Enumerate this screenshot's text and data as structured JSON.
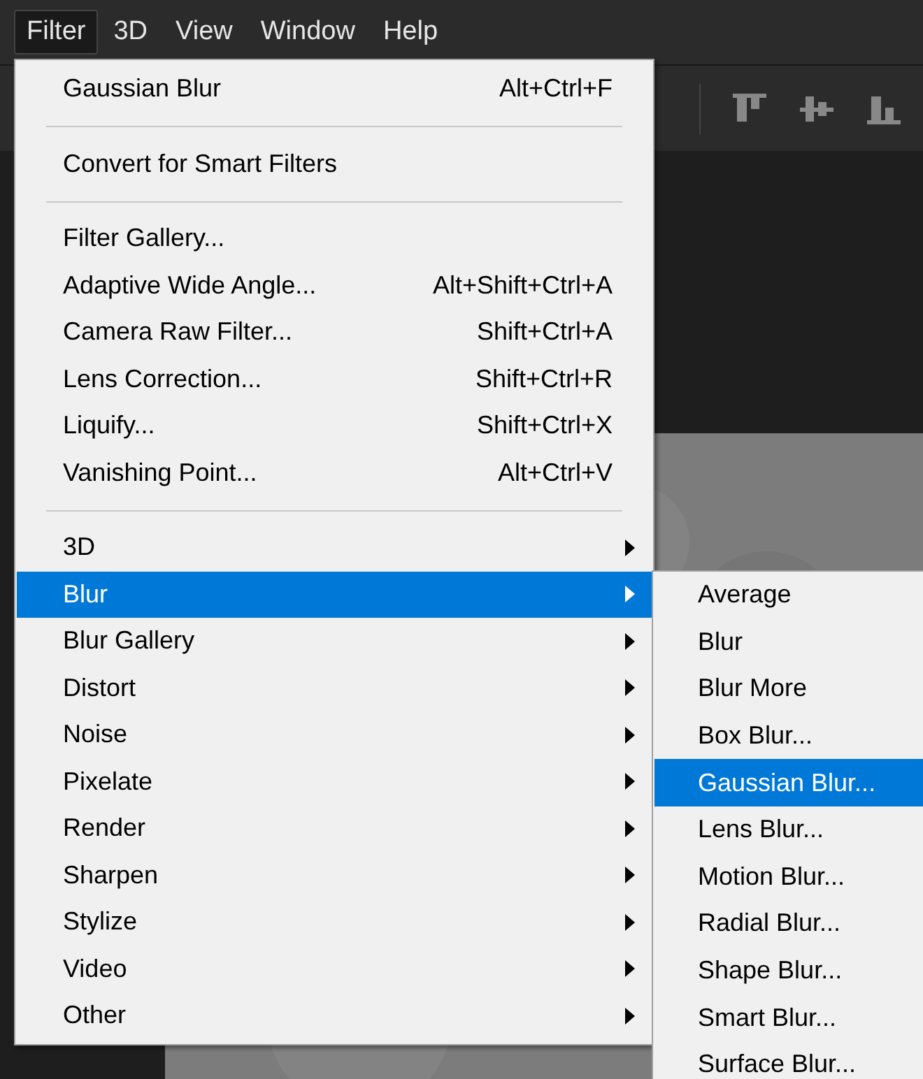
{
  "menubar": [
    {
      "label": "Filter",
      "selected": true
    },
    {
      "label": "3D",
      "selected": false
    },
    {
      "label": "View",
      "selected": false
    },
    {
      "label": "Window",
      "selected": false
    },
    {
      "label": "Help",
      "selected": false
    }
  ],
  "menu": {
    "items": [
      {
        "kind": "item",
        "label": "Gaussian Blur",
        "shortcut": "Alt+Ctrl+F",
        "selected": false
      },
      {
        "kind": "separator"
      },
      {
        "kind": "item",
        "label": "Convert for Smart Filters",
        "selected": false
      },
      {
        "kind": "separator"
      },
      {
        "kind": "item",
        "label": "Filter Gallery...",
        "selected": false
      },
      {
        "kind": "item",
        "label": "Adaptive Wide Angle...",
        "shortcut": "Alt+Shift+Ctrl+A",
        "selected": false
      },
      {
        "kind": "item",
        "label": "Camera Raw Filter...",
        "shortcut": "Shift+Ctrl+A",
        "selected": false
      },
      {
        "kind": "item",
        "label": "Lens Correction...",
        "shortcut": "Shift+Ctrl+R",
        "selected": false
      },
      {
        "kind": "item",
        "label": "Liquify...",
        "shortcut": "Shift+Ctrl+X",
        "selected": false
      },
      {
        "kind": "item",
        "label": "Vanishing Point...",
        "shortcut": "Alt+Ctrl+V",
        "selected": false
      },
      {
        "kind": "separator"
      },
      {
        "kind": "submenu",
        "label": "3D",
        "selected": false
      },
      {
        "kind": "submenu",
        "label": "Blur",
        "selected": true
      },
      {
        "kind": "submenu",
        "label": "Blur Gallery",
        "selected": false
      },
      {
        "kind": "submenu",
        "label": "Distort",
        "selected": false
      },
      {
        "kind": "submenu",
        "label": "Noise",
        "selected": false
      },
      {
        "kind": "submenu",
        "label": "Pixelate",
        "selected": false
      },
      {
        "kind": "submenu",
        "label": "Render",
        "selected": false
      },
      {
        "kind": "submenu",
        "label": "Sharpen",
        "selected": false
      },
      {
        "kind": "submenu",
        "label": "Stylize",
        "selected": false
      },
      {
        "kind": "submenu",
        "label": "Video",
        "selected": false
      },
      {
        "kind": "submenu",
        "label": "Other",
        "selected": false
      }
    ]
  },
  "submenu": {
    "items": [
      {
        "label": "Average",
        "selected": false
      },
      {
        "label": "Blur",
        "selected": false
      },
      {
        "label": "Blur More",
        "selected": false
      },
      {
        "label": "Box Blur...",
        "selected": false
      },
      {
        "label": "Gaussian Blur...",
        "selected": true
      },
      {
        "label": "Lens Blur...",
        "selected": false
      },
      {
        "label": "Motion Blur...",
        "selected": false
      },
      {
        "label": "Radial Blur...",
        "selected": false
      },
      {
        "label": "Shape Blur...",
        "selected": false
      },
      {
        "label": "Smart Blur...",
        "selected": false
      },
      {
        "label": "Surface Blur...",
        "selected": false
      }
    ]
  }
}
